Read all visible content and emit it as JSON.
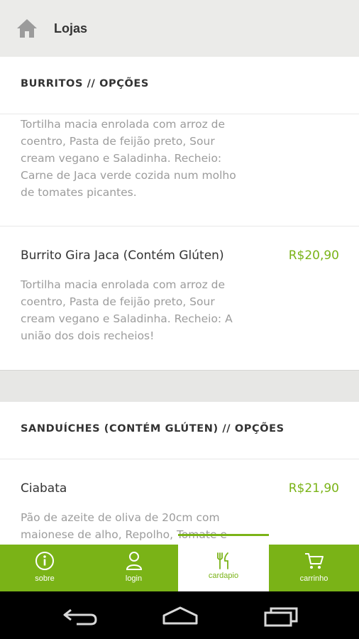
{
  "topbar": {
    "title": "Lojas",
    "icon": "home-icon"
  },
  "sections": [
    {
      "title": "BURRITOS // OPÇÕES"
    },
    {
      "title": "SANDUÍCHES (CONTÉM GLÚTEN) // OPÇÕES"
    }
  ],
  "items": [
    {
      "description": "Tortilha macia enrolada com arroz de coentro, Pasta de feijão preto, Sour cream vegano e Saladinha. Recheio: Carne de Jaca verde cozida num molho de tomates picantes."
    },
    {
      "name": "Burrito Gira Jaca (Contém Glúten)",
      "price": "R$20,90",
      "description": "Tortilha macia enrolada com arroz de coentro, Pasta de feijão preto, Sour cream vegano e Saladinha. Recheio: A união dos dois recheios!"
    },
    {
      "name": "Ciabata",
      "price": "R$21,90",
      "description": "Pão de azeite de oliva de 20cm com maionese de alho, Repolho, Tomate e"
    }
  ],
  "bottom_nav": [
    {
      "label": "sobre",
      "icon": "info-icon"
    },
    {
      "label": "login",
      "icon": "user-icon"
    },
    {
      "label": "cardapio",
      "icon": "fork-knife-icon",
      "active": true
    },
    {
      "label": "carrinho",
      "icon": "cart-icon"
    }
  ],
  "colors": {
    "accent": "#7ab317",
    "topbar_bg": "#ebebe9",
    "gap_bg": "#e7e7e5"
  }
}
